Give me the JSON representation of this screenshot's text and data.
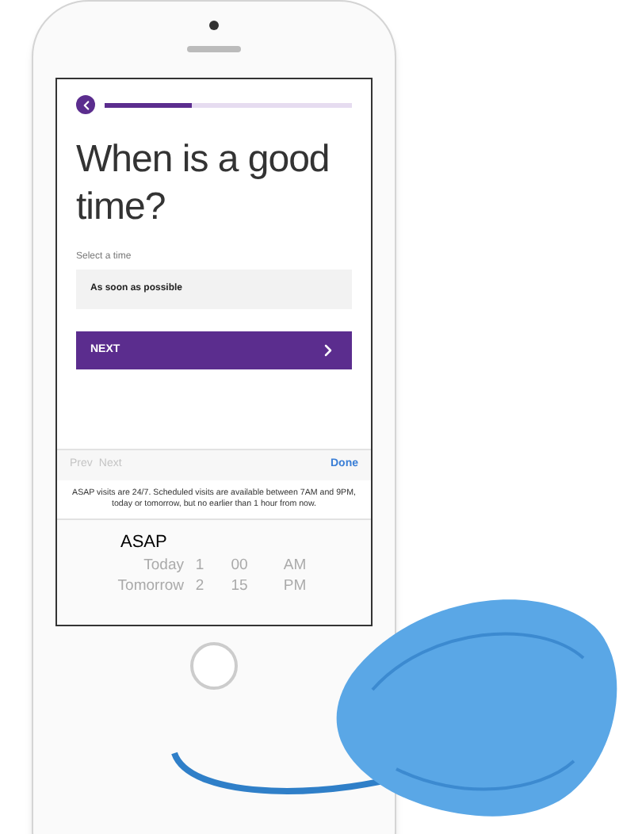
{
  "progress": {
    "level": 0.35
  },
  "heading": "When is a good time?",
  "field": {
    "label": "Select a time",
    "value": "As soon as possible"
  },
  "next_button": {
    "label": "NEXT"
  },
  "toolbar": [
    {
      "label": "Prev",
      "kind": "nav",
      "disabled": true
    },
    {
      "label": "Next",
      "kind": "nav",
      "disabled": true
    },
    {
      "label": "Done",
      "kind": "action",
      "disabled": false
    }
  ],
  "note": "ASAP visits are 24/7. Scheduled visits are available between 7AM and 9PM, today or tomorrow, but no earlier than 1 hour from now.",
  "picker": {
    "rows": [
      {
        "day": "ASAP",
        "selected": true
      },
      {
        "day": "Today",
        "hour": "1",
        "minute": "00",
        "period": "AM",
        "selected": false
      },
      {
        "day": "Tomorrow",
        "hour": "2",
        "minute": "15",
        "period": "PM",
        "selected": false
      }
    ]
  }
}
